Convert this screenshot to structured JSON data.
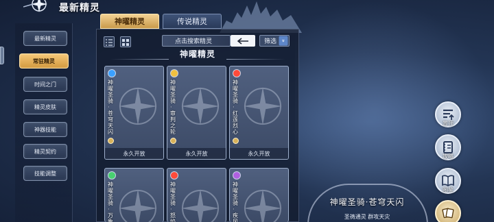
{
  "header": {
    "title": "最新精灵"
  },
  "sidebar": {
    "items": [
      {
        "label": "最新精灵",
        "active": false
      },
      {
        "label": "常驻精灵",
        "active": true
      },
      {
        "label": "时间之门",
        "active": false
      },
      {
        "label": "精灵皮肤",
        "active": false
      },
      {
        "label": "神器技能",
        "active": false
      },
      {
        "label": "精灵契约",
        "active": false
      },
      {
        "label": "技能调整",
        "active": false
      }
    ]
  },
  "tabs": [
    {
      "label": "神曜精灵",
      "active": true
    },
    {
      "label": "传说精灵",
      "active": false
    }
  ],
  "toolbar": {
    "search_placeholder": "点击搜索精灵",
    "filter_label": "筛选",
    "filter_chevron": "»"
  },
  "section": {
    "title": "神曜精灵"
  },
  "cards": [
    {
      "name": "神曜圣骑·苍穹天闪",
      "element_icon": "water-element-icon",
      "element_color": "#3aa0ff",
      "status": "永久开放"
    },
    {
      "name": "神曜圣骑·审判之轮",
      "element_icon": "light-element-icon",
      "element_color": "#f0c040",
      "status": "永久开放"
    },
    {
      "name": "神曜圣骑·红莲烈心",
      "element_icon": "fire-element-icon",
      "element_color": "#ff4a3a",
      "status": "永久开放"
    },
    {
      "name": "神曜圣骑·万象",
      "element_icon": "grass-element-icon",
      "element_color": "#48d070",
      "status": ""
    },
    {
      "name": "神曜圣骑·怒焰",
      "element_icon": "fire-element-icon",
      "element_color": "#ff4a3a",
      "status": ""
    },
    {
      "name": "神曜圣骑·疾风",
      "element_icon": "dark-element-icon",
      "element_color": "#b060e0",
      "status": ""
    }
  ],
  "right_buttons": [
    {
      "label": "置顶",
      "icon": "pin-top-icon"
    },
    {
      "label": "攻略",
      "icon": "notebook-icon"
    },
    {
      "label": "图鉴",
      "icon": "book-icon"
    },
    {
      "label": "",
      "icon": "cards-icon"
    }
  ],
  "featured": {
    "name": "神曜圣骑·苍穹天闪",
    "subtitle": "圣祷通灵 群攻天灾"
  }
}
